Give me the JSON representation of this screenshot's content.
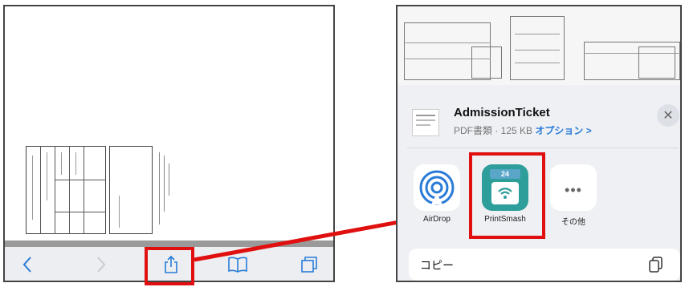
{
  "left_toolbar": {
    "icons": [
      "back-icon",
      "forward-icon",
      "share-icon",
      "bookmarks-icon",
      "tabs-icon"
    ]
  },
  "share_sheet": {
    "file_name": "AdmissionTicket",
    "file_meta": "PDF書類 · 125 KB",
    "options_label": "オプション >",
    "close_glyph": "✕",
    "apps": [
      {
        "label": "AirDrop"
      },
      {
        "label": "PrintSmash",
        "badge": "24"
      },
      {
        "label": "その他"
      }
    ],
    "copy_label": "コピー"
  },
  "colors": {
    "highlight": "#e01010",
    "ios_blue": "#2a7bd8",
    "printsmash_teal": "#2e9e9a",
    "printsmash_top": "#5aa6c8"
  }
}
